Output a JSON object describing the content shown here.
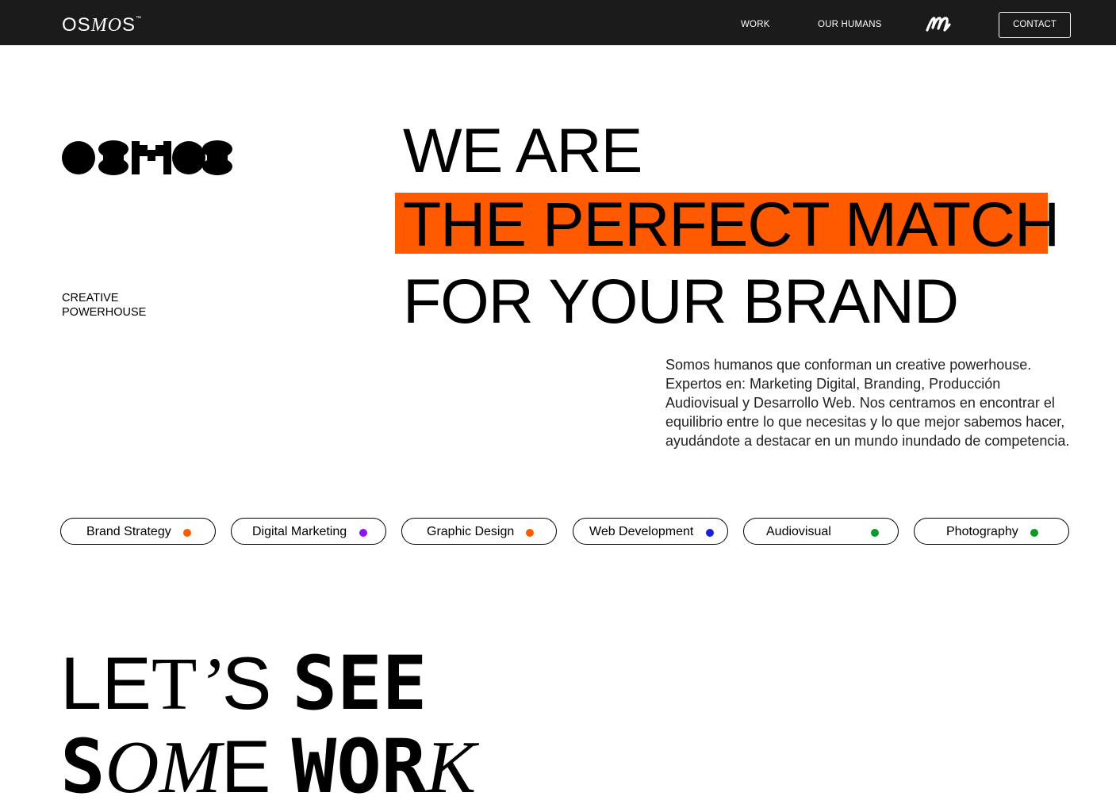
{
  "nav": {
    "logo_os": "OS",
    "logo_mo": "MO",
    "logo_s": "S",
    "logo_tm": "™",
    "links": {
      "work": "WORK",
      "humans": "OUR HUMANS"
    },
    "m_glyph": "m",
    "contact": "CONTACT"
  },
  "hero": {
    "logo_alt": "OSMOS",
    "tagline": [
      "CREATIVE",
      "POWERHOUSE"
    ],
    "headline": [
      "WE ARE",
      "THE PERFECT MATCH",
      "FOR YOUR BRAND"
    ],
    "highlight_color": "#ff5a00",
    "description": "Somos humanos que conforman un creative powerhouse. Expertos en: Marketing Digital, Branding, Producción Audiovisual y Desarrollo Web. Nos centramos en encontrar el equilibrio entre lo que necesitas y lo que mejor sabemos hacer, ayudándote a destacar en un mundo inundado de competencia."
  },
  "services": [
    {
      "label": "Brand Strategy",
      "color": "#ff5a00"
    },
    {
      "label": "Digital Marketing",
      "color": "#8a17ff"
    },
    {
      "label": "Graphic Design",
      "color": "#ff5a00"
    },
    {
      "label": "Web Development",
      "color": "#1d1de0"
    },
    {
      "label": "Audiovisual",
      "color": "#0a9a2a"
    },
    {
      "label": "Photography",
      "color": "#0a9a2a"
    }
  ],
  "work_title": {
    "line1": {
      "le": "LE",
      "t": "T",
      "apos": "’",
      "s": "S",
      "see": "SEE"
    },
    "line2": {
      "s": "S",
      "om": "OM",
      "e": "E",
      "wor": "WOR",
      "k": "K"
    }
  }
}
